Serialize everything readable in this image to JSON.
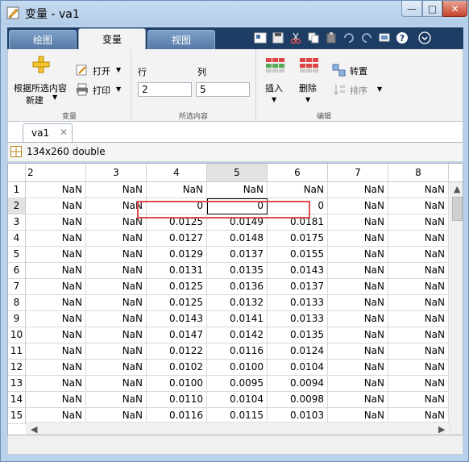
{
  "window": {
    "title": "变量 - va1",
    "minimize": "—",
    "maximize": "□",
    "close": "✕"
  },
  "ribbon": {
    "tabs": [
      "绘图",
      "变量",
      "视图"
    ],
    "new_from_selection": {
      "line1": "根据所选内容",
      "line2": "新建"
    },
    "open": "打开",
    "print": "打印",
    "row_label": "行",
    "col_label": "列",
    "row_value": "2",
    "col_value": "5",
    "insert": "插入",
    "delete": "删除",
    "transpose": "转置",
    "sort": "排序",
    "sections": {
      "variable": "变量",
      "selection": "所选内容",
      "edit": "编辑"
    }
  },
  "doc": {
    "tab": "va1",
    "info": "134x260 double"
  },
  "grid": {
    "columns": [
      "2",
      "3",
      "4",
      "5",
      "6",
      "7",
      "8"
    ],
    "rows": [
      {
        "n": "1",
        "v": [
          "NaN",
          "NaN",
          "NaN",
          "NaN",
          "NaN",
          "NaN",
          "NaN"
        ]
      },
      {
        "n": "2",
        "v": [
          "NaN",
          "NaN",
          "0",
          "0",
          "0",
          "NaN",
          "NaN"
        ]
      },
      {
        "n": "3",
        "v": [
          "NaN",
          "NaN",
          "0.0125",
          "0.0149",
          "0.0181",
          "NaN",
          "NaN"
        ]
      },
      {
        "n": "4",
        "v": [
          "NaN",
          "NaN",
          "0.0127",
          "0.0148",
          "0.0175",
          "NaN",
          "NaN"
        ]
      },
      {
        "n": "5",
        "v": [
          "NaN",
          "NaN",
          "0.0129",
          "0.0137",
          "0.0155",
          "NaN",
          "NaN"
        ]
      },
      {
        "n": "6",
        "v": [
          "NaN",
          "NaN",
          "0.0131",
          "0.0135",
          "0.0143",
          "NaN",
          "NaN"
        ]
      },
      {
        "n": "7",
        "v": [
          "NaN",
          "NaN",
          "0.0125",
          "0.0136",
          "0.0137",
          "NaN",
          "NaN"
        ]
      },
      {
        "n": "8",
        "v": [
          "NaN",
          "NaN",
          "0.0125",
          "0.0132",
          "0.0133",
          "NaN",
          "NaN"
        ]
      },
      {
        "n": "9",
        "v": [
          "NaN",
          "NaN",
          "0.0143",
          "0.0141",
          "0.0133",
          "NaN",
          "NaN"
        ]
      },
      {
        "n": "10",
        "v": [
          "NaN",
          "NaN",
          "0.0147",
          "0.0142",
          "0.0135",
          "NaN",
          "NaN"
        ]
      },
      {
        "n": "11",
        "v": [
          "NaN",
          "NaN",
          "0.0122",
          "0.0116",
          "0.0124",
          "NaN",
          "NaN"
        ]
      },
      {
        "n": "12",
        "v": [
          "NaN",
          "NaN",
          "0.0102",
          "0.0100",
          "0.0104",
          "NaN",
          "NaN"
        ]
      },
      {
        "n": "13",
        "v": [
          "NaN",
          "NaN",
          "0.0100",
          "0.0095",
          "0.0094",
          "NaN",
          "NaN"
        ]
      },
      {
        "n": "14",
        "v": [
          "NaN",
          "NaN",
          "0.0110",
          "0.0104",
          "0.0098",
          "NaN",
          "NaN"
        ]
      },
      {
        "n": "15",
        "v": [
          "NaN",
          "NaN",
          "0.0116",
          "0.0115",
          "0.0103",
          "NaN",
          "NaN"
        ]
      }
    ],
    "selected_column": "5",
    "selected_row": "2"
  },
  "colors": {
    "highlight_box": "#e04b4b",
    "title_bar": "#b9d1ea",
    "ribbon_dark": "#1d3d65"
  }
}
